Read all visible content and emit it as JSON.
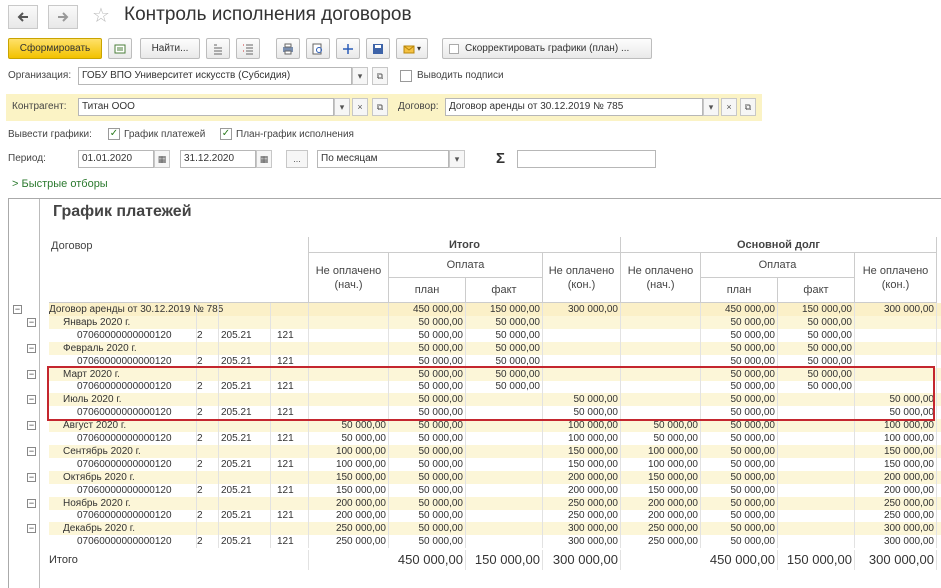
{
  "window": {
    "title": "Контроль исполнения договоров",
    "icons": [
      "arrow-left-icon",
      "arrow-right-icon",
      "star-icon"
    ]
  },
  "toolbar": {
    "generate_label": "Сформировать",
    "find_label": "Найти...",
    "adjust_label": "Скорректировать графики (план) ...",
    "accent_color": "#f2c200"
  },
  "filters": {
    "org_label": "Организация:",
    "org_value": "ГОБУ ВПО Университет искусств (Субсидия)",
    "print_signatures_label": "Выводить подписи",
    "counterparty_label": "Контрагент:",
    "counterparty_value": "Титан ООО",
    "contract_label": "Договор:",
    "contract_value": "Договор аренды от 30.12.2019 № 785",
    "show_charts_label": "Вывести графики:",
    "chart_payments_label": "График платежей",
    "chart_execution_label": "План-график исполнения",
    "period_label": "Период:",
    "date_from": "01.01.2020",
    "date_to": "31.12.2020",
    "period_button": "...",
    "period_mode": "По месяцам",
    "sigma": "Σ",
    "sigma_value": "",
    "quick_filters": "Быстрые отборы"
  },
  "report": {
    "title": "График платежей",
    "headers": {
      "contract": "Договор",
      "total": "Итого",
      "principal": "Основной долг",
      "unpaid_start": "Не оплачено (нач.)",
      "payment": "Оплата",
      "plan": "план",
      "fact": "факт",
      "unpaid_end": "Не оплачено (кон.)"
    },
    "rows": [
      {
        "kind": "top",
        "label": "Договор аренды от 30.12.2019 № 785",
        "n1": "",
        "n2": "",
        "n3": "",
        "n4": "",
        "t_unp": "",
        "t_plan": "450 000,00",
        "t_fact": "150 000,00",
        "t_end": "300 000,00",
        "p_unp": "",
        "p_plan": "450 000,00",
        "p_fact": "150 000,00",
        "p_end": "300 000,00"
      },
      {
        "kind": "group",
        "label": "Январь 2020 г.",
        "n1": "",
        "n2": "",
        "n3": "",
        "n4": "",
        "t_unp": "",
        "t_plan": "50 000,00",
        "t_fact": "50 000,00",
        "t_end": "",
        "p_unp": "",
        "p_plan": "50 000,00",
        "p_fact": "50 000,00",
        "p_end": ""
      },
      {
        "kind": "item",
        "label": "07060000000000120",
        "n1": "2",
        "n2": "205.21",
        "n3": "121",
        "n4": "",
        "t_unp": "",
        "t_plan": "50 000,00",
        "t_fact": "50 000,00",
        "t_end": "",
        "p_unp": "",
        "p_plan": "50 000,00",
        "p_fact": "50 000,00",
        "p_end": ""
      },
      {
        "kind": "group",
        "label": "Февраль 2020 г.",
        "n1": "",
        "n2": "",
        "n3": "",
        "n4": "",
        "t_unp": "",
        "t_plan": "50 000,00",
        "t_fact": "50 000,00",
        "t_end": "",
        "p_unp": "",
        "p_plan": "50 000,00",
        "p_fact": "50 000,00",
        "p_end": ""
      },
      {
        "kind": "item",
        "label": "07060000000000120",
        "n1": "2",
        "n2": "205.21",
        "n3": "121",
        "n4": "",
        "t_unp": "",
        "t_plan": "50 000,00",
        "t_fact": "50 000,00",
        "t_end": "",
        "p_unp": "",
        "p_plan": "50 000,00",
        "p_fact": "50 000,00",
        "p_end": ""
      },
      {
        "kind": "group",
        "label": "Март 2020 г.",
        "n1": "",
        "n2": "",
        "n3": "",
        "n4": "",
        "t_unp": "",
        "t_plan": "50 000,00",
        "t_fact": "50 000,00",
        "t_end": "",
        "p_unp": "",
        "p_plan": "50 000,00",
        "p_fact": "50 000,00",
        "p_end": ""
      },
      {
        "kind": "item",
        "label": "07060000000000120",
        "n1": "2",
        "n2": "205.21",
        "n3": "121",
        "n4": "",
        "t_unp": "",
        "t_plan": "50 000,00",
        "t_fact": "50 000,00",
        "t_end": "",
        "p_unp": "",
        "p_plan": "50 000,00",
        "p_fact": "50 000,00",
        "p_end": ""
      },
      {
        "kind": "group",
        "label": "Июль 2020 г.",
        "n1": "",
        "n2": "",
        "n3": "",
        "n4": "",
        "t_unp": "",
        "t_plan": "50 000,00",
        "t_fact": "",
        "t_end": "50 000,00",
        "p_unp": "",
        "p_plan": "50 000,00",
        "p_fact": "",
        "p_end": "50 000,00"
      },
      {
        "kind": "item",
        "label": "07060000000000120",
        "n1": "2",
        "n2": "205.21",
        "n3": "121",
        "n4": "",
        "t_unp": "",
        "t_plan": "50 000,00",
        "t_fact": "",
        "t_end": "50 000,00",
        "p_unp": "",
        "p_plan": "50 000,00",
        "p_fact": "",
        "p_end": "50 000,00"
      },
      {
        "kind": "group",
        "label": "Август 2020 г.",
        "n1": "",
        "n2": "",
        "n3": "",
        "n4": "",
        "t_unp": "50 000,00",
        "t_plan": "50 000,00",
        "t_fact": "",
        "t_end": "100 000,00",
        "p_unp": "50 000,00",
        "p_plan": "50 000,00",
        "p_fact": "",
        "p_end": "100 000,00"
      },
      {
        "kind": "item",
        "label": "07060000000000120",
        "n1": "2",
        "n2": "205.21",
        "n3": "121",
        "n4": "",
        "t_unp": "50 000,00",
        "t_plan": "50 000,00",
        "t_fact": "",
        "t_end": "100 000,00",
        "p_unp": "50 000,00",
        "p_plan": "50 000,00",
        "p_fact": "",
        "p_end": "100 000,00"
      },
      {
        "kind": "group",
        "label": "Сентябрь 2020 г.",
        "n1": "",
        "n2": "",
        "n3": "",
        "n4": "",
        "t_unp": "100 000,00",
        "t_plan": "50 000,00",
        "t_fact": "",
        "t_end": "150 000,00",
        "p_unp": "100 000,00",
        "p_plan": "50 000,00",
        "p_fact": "",
        "p_end": "150 000,00"
      },
      {
        "kind": "item",
        "label": "07060000000000120",
        "n1": "2",
        "n2": "205.21",
        "n3": "121",
        "n4": "",
        "t_unp": "100 000,00",
        "t_plan": "50 000,00",
        "t_fact": "",
        "t_end": "150 000,00",
        "p_unp": "100 000,00",
        "p_plan": "50 000,00",
        "p_fact": "",
        "p_end": "150 000,00"
      },
      {
        "kind": "group",
        "label": "Октябрь 2020 г.",
        "n1": "",
        "n2": "",
        "n3": "",
        "n4": "",
        "t_unp": "150 000,00",
        "t_plan": "50 000,00",
        "t_fact": "",
        "t_end": "200 000,00",
        "p_unp": "150 000,00",
        "p_plan": "50 000,00",
        "p_fact": "",
        "p_end": "200 000,00"
      },
      {
        "kind": "item",
        "label": "07060000000000120",
        "n1": "2",
        "n2": "205.21",
        "n3": "121",
        "n4": "",
        "t_unp": "150 000,00",
        "t_plan": "50 000,00",
        "t_fact": "",
        "t_end": "200 000,00",
        "p_unp": "150 000,00",
        "p_plan": "50 000,00",
        "p_fact": "",
        "p_end": "200 000,00"
      },
      {
        "kind": "group",
        "label": "Ноябрь 2020 г.",
        "n1": "",
        "n2": "",
        "n3": "",
        "n4": "",
        "t_unp": "200 000,00",
        "t_plan": "50 000,00",
        "t_fact": "",
        "t_end": "250 000,00",
        "p_unp": "200 000,00",
        "p_plan": "50 000,00",
        "p_fact": "",
        "p_end": "250 000,00"
      },
      {
        "kind": "item",
        "label": "07060000000000120",
        "n1": "2",
        "n2": "205.21",
        "n3": "121",
        "n4": "",
        "t_unp": "200 000,00",
        "t_plan": "50 000,00",
        "t_fact": "",
        "t_end": "250 000,00",
        "p_unp": "200 000,00",
        "p_plan": "50 000,00",
        "p_fact": "",
        "p_end": "250 000,00"
      },
      {
        "kind": "group",
        "label": "Декабрь 2020 г.",
        "n1": "",
        "n2": "",
        "n3": "",
        "n4": "",
        "t_unp": "250 000,00",
        "t_plan": "50 000,00",
        "t_fact": "",
        "t_end": "300 000,00",
        "p_unp": "250 000,00",
        "p_plan": "50 000,00",
        "p_fact": "",
        "p_end": "300 000,00"
      },
      {
        "kind": "item",
        "label": "07060000000000120",
        "n1": "2",
        "n2": "205.21",
        "n3": "121",
        "n4": "",
        "t_unp": "250 000,00",
        "t_plan": "50 000,00",
        "t_fact": "",
        "t_end": "300 000,00",
        "p_unp": "250 000,00",
        "p_plan": "50 000,00",
        "p_fact": "",
        "p_end": "300 000,00"
      }
    ],
    "totals": {
      "label": "Итого",
      "t_plan": "450 000,00",
      "t_fact": "150 000,00",
      "t_end": "300 000,00",
      "p_plan": "450 000,00",
      "p_fact": "150 000,00",
      "p_end": "300 000,00"
    },
    "highlight_color": "#c4262e"
  }
}
